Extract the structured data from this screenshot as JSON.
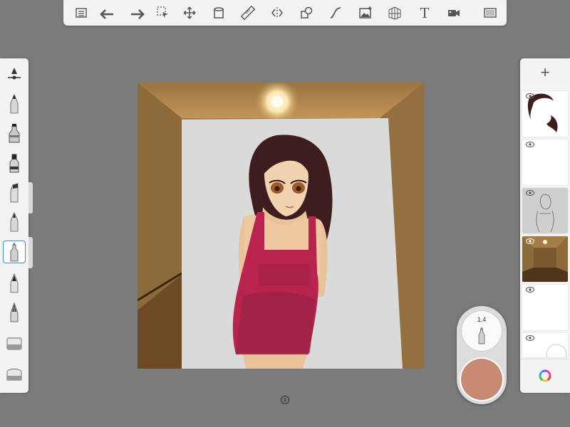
{
  "toolbar": {
    "icons": [
      "list-icon",
      "undo-icon",
      "redo-icon",
      "select-icon",
      "move-icon",
      "copy-icon",
      "ruler-icon",
      "symmetry-icon",
      "shapes-icon",
      "curve-icon",
      "image-icon",
      "perspective-icon",
      "text-icon",
      "recording-icon",
      "fullscreen-icon"
    ],
    "text_tool_label": "T"
  },
  "brushes": {
    "icons": [
      "brush-settings-icon",
      "pencil-icon",
      "airbrush-icon",
      "marker-icon",
      "chisel-icon",
      "ballpoint-icon",
      "fineliner-icon",
      "fountain-pen-icon",
      "ink-pen-icon",
      "eraser-icon",
      "soft-eraser-icon"
    ],
    "selected": "fineliner-icon"
  },
  "layers": {
    "add_label": "+",
    "items": [
      "hair-layer",
      "blank-layer",
      "sketch-layer",
      "background-layer",
      "empty-layer",
      "partial-layer"
    ]
  },
  "puck": {
    "size_label": "1.4",
    "color": "#c98a74"
  },
  "colors": {
    "accent": "#3d8ce0",
    "background": "#7b7b7b",
    "panel": "#f3f3f3"
  }
}
